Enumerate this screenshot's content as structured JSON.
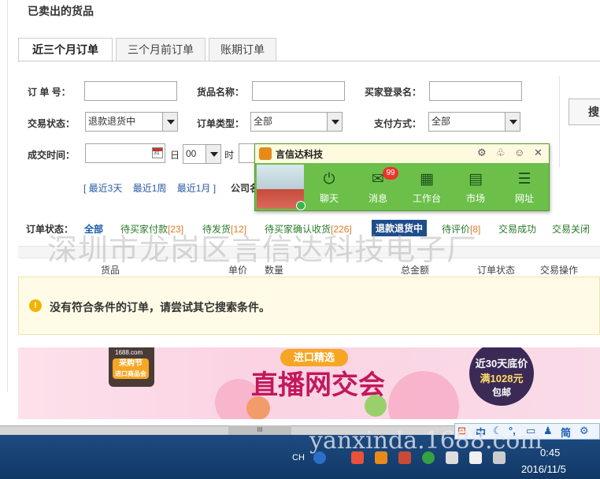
{
  "page": {
    "title": "已卖出的货品"
  },
  "tabs": [
    "近三个月订单",
    "三个月前订单",
    "账期订单"
  ],
  "filters": {
    "order_no_label": "订 单 号：",
    "goods_name_label": "货品名称：",
    "buyer_login_label": "买家登录名：",
    "trade_status_label": "交易状态：",
    "trade_status_value": "退款退货中",
    "order_type_label": "订单类型：",
    "order_type_value": "全部",
    "pay_method_label": "支付方式：",
    "pay_method_value": "全部",
    "deal_time_label": "成交时间：",
    "day_label": "日",
    "hour_value": "00",
    "hour_label": "时",
    "search_button": "搜",
    "quick_ranges": [
      "[ 最近3天",
      "最近1周",
      "最近1月 ]"
    ],
    "company_label": "公司名"
  },
  "status_tabs": {
    "label": "订单状态：",
    "items": [
      {
        "text": "全部",
        "count": ""
      },
      {
        "text": "待买家付款",
        "count": "[23]"
      },
      {
        "text": "待发货",
        "count": "[12]"
      },
      {
        "text": "待买家确认收货",
        "count": "[226]"
      },
      {
        "text": "退款退货中",
        "count": ""
      },
      {
        "text": "待评价",
        "count": "[8]"
      },
      {
        "text": "交易成功",
        "count": ""
      },
      {
        "text": "交易关闭",
        "count": ""
      }
    ]
  },
  "table": {
    "headers": [
      "货品",
      "单价",
      "数量",
      "总金额",
      "订单状态",
      "交易操作"
    ],
    "empty_message": "没有符合条件的订单，请尝试其它搜索条件。"
  },
  "banner": {
    "site_tag": "1688.com",
    "logo_line1": "采购节",
    "logo_line2": "进口商品会",
    "subtitle": "进口精选",
    "title": "直播网交会",
    "promo_line1": "近30天底价",
    "promo_line2": "满1028元",
    "promo_line3": "包邮"
  },
  "im_popup": {
    "name": "言信达科技",
    "message_count": "99",
    "items": [
      "聊天",
      "消息",
      "工作台",
      "市场",
      "网址"
    ]
  },
  "watermarks": {
    "company": "深圳市龙岗区言信达科技电子厂",
    "site": "yanxinda.1688.com"
  },
  "ime_bar": {
    "items": [
      "中",
      "简"
    ]
  },
  "taskbar": {
    "lang": "CH",
    "time": "0:45",
    "date": "2016/11/5"
  },
  "scroll_thumb": "III",
  "calendar_day": "31"
}
